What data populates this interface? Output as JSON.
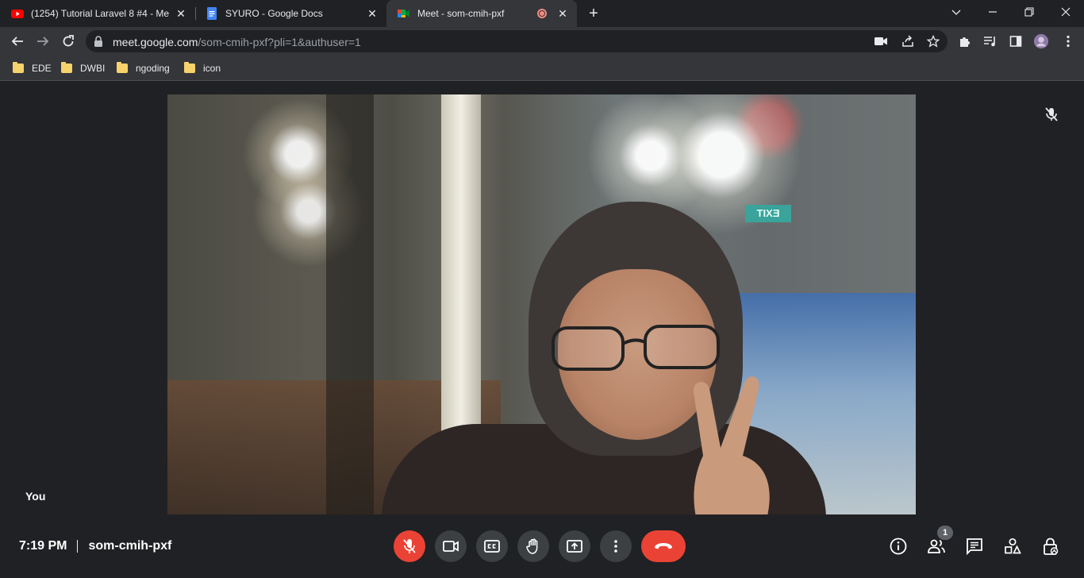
{
  "browser": {
    "tabs": [
      {
        "title": "(1254) Tutorial Laravel 8 #4 - Me",
        "icon": "youtube-icon"
      },
      {
        "title": "SYURO - Google Docs",
        "icon": "google-docs-icon"
      },
      {
        "title": "Meet - som-cmih-pxf",
        "icon": "google-meet-icon",
        "active": true
      }
    ],
    "url_host": "meet.google.com",
    "url_path": "/som-cmih-pxf?pli=1&authuser=1",
    "bookmarks": [
      "EDE",
      "DWBI",
      "ngoding",
      "icon"
    ]
  },
  "video": {
    "exit_sign": "EXIT",
    "tile_label": "You"
  },
  "meeting": {
    "time": "7:19 PM",
    "code": "som-cmih-pxf",
    "participant_count": "1"
  },
  "colors": {
    "end_call": "#ea4335",
    "control_bg": "#3c4043",
    "background": "#202124"
  }
}
